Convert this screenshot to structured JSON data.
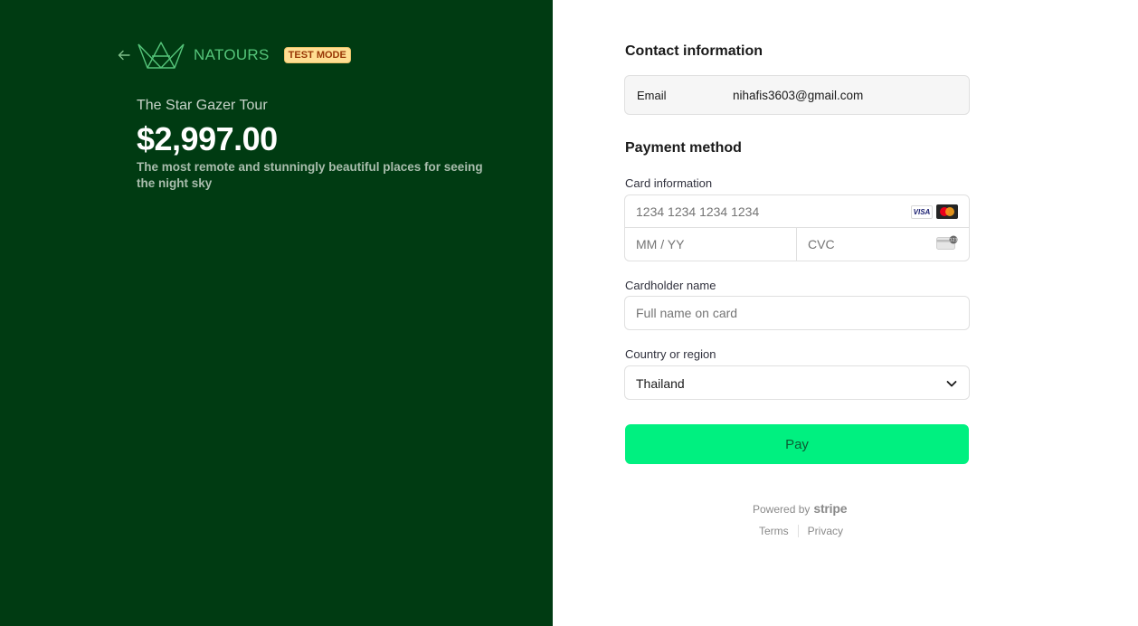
{
  "merchant": {
    "name": "NATOURS",
    "test_badge": "TEST MODE",
    "icons": {
      "back": "arrow-left-icon",
      "logo": "crown-logo"
    }
  },
  "product": {
    "name": "The Star Gazer Tour",
    "price": "$2,997.00",
    "description": "The most remote and stunningly beautiful places for seeing the night sky"
  },
  "contact": {
    "title": "Contact information",
    "email_label": "Email",
    "email_value": "nihafis3603@gmail.com"
  },
  "payment": {
    "title": "Payment method",
    "card_label": "Card information",
    "card_number_placeholder": "1234 1234 1234 1234",
    "expiry_placeholder": "MM / YY",
    "cvc_placeholder": "CVC",
    "visa_text": "VISA",
    "cardholder_label": "Cardholder name",
    "cardholder_placeholder": "Full name on card",
    "country_label": "Country or region",
    "country_value": "Thailand",
    "pay_label": "Pay"
  },
  "footer": {
    "powered_by": "Powered by",
    "stripe": "stripe",
    "terms": "Terms",
    "privacy": "Privacy"
  },
  "colors": {
    "left_bg": "#003b12",
    "brand_green": "#55c57a",
    "pay_button": "#00f080",
    "badge_bg": "#ffde92"
  }
}
